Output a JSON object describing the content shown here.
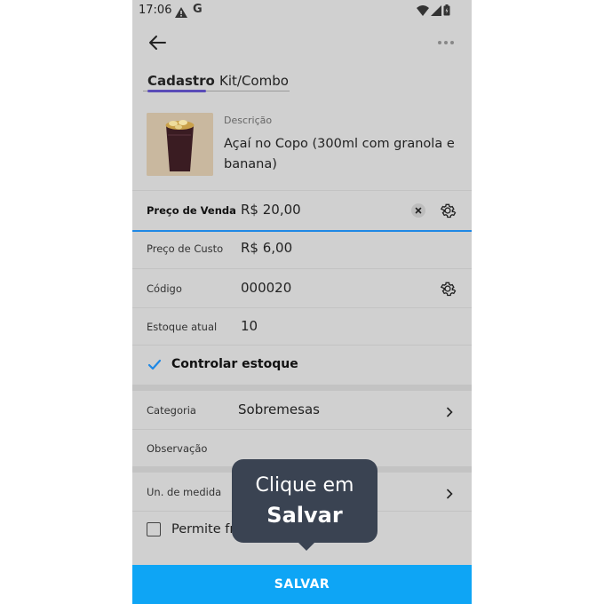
{
  "status_bar": {
    "time": "17:06",
    "g_label": "G"
  },
  "tabs": [
    {
      "label": "Cadastro",
      "active": true
    },
    {
      "label": "Kit/Combo",
      "active": false
    }
  ],
  "product": {
    "description_label": "Descrição",
    "description_value": "Açaí no Copo (300ml com granola e banana)"
  },
  "fields": {
    "sale_price": {
      "label": "Preço de Venda",
      "value": "R$ 20,00"
    },
    "cost_price": {
      "label": "Preço de Custo",
      "value": "R$ 6,00"
    },
    "code": {
      "label": "Código",
      "value": "000020"
    },
    "stock": {
      "label": "Estoque atual",
      "value": "10"
    },
    "control_stock": {
      "label": "Controlar estoque",
      "checked": true
    },
    "category": {
      "label": "Categoria",
      "value": "Sobremesas"
    },
    "notes": {
      "label": "Observação",
      "value": ""
    },
    "unit": {
      "label": "Un. de medida",
      "value": ""
    },
    "fractional": {
      "label": "Permite fr",
      "checked": false
    }
  },
  "tooltip": {
    "line1": "Clique em",
    "line2": "Salvar"
  },
  "save_button": {
    "label": "SALVAR"
  },
  "colors": {
    "accent": "#0ea5f5",
    "tab_indicator": "#5a4cb8",
    "tooltip_bg": "#3a4352",
    "check": "#1e88e5"
  }
}
